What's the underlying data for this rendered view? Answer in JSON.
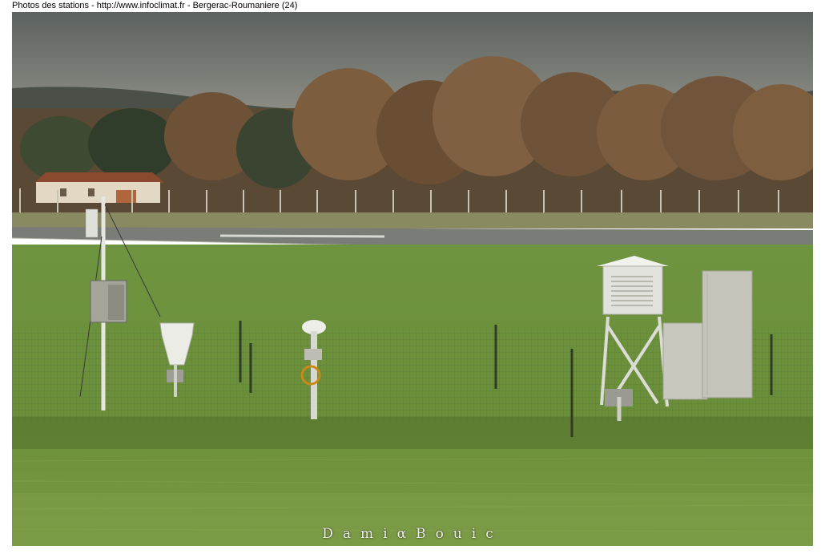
{
  "header": {
    "caption": "Photos des stations - http://www.infoclimat.fr - Bergerac-Roumaniere (24)"
  },
  "photo": {
    "watermark": "DamiαBouic",
    "colors": {
      "sky": "#6d7270",
      "sky_horizon": "#8e8f86",
      "distant_hills": "#4a5048",
      "trees": "#7a5a3c",
      "runway": "#7a7c78",
      "grass": "#6b8e3a",
      "grass_dark": "#4f6e2a"
    },
    "objects": [
      "mast-with-sensors",
      "rain-gauge",
      "ground-sensor-post",
      "stevenson-screen",
      "equipment-cabinet",
      "wire-fence",
      "house",
      "runway"
    ]
  }
}
